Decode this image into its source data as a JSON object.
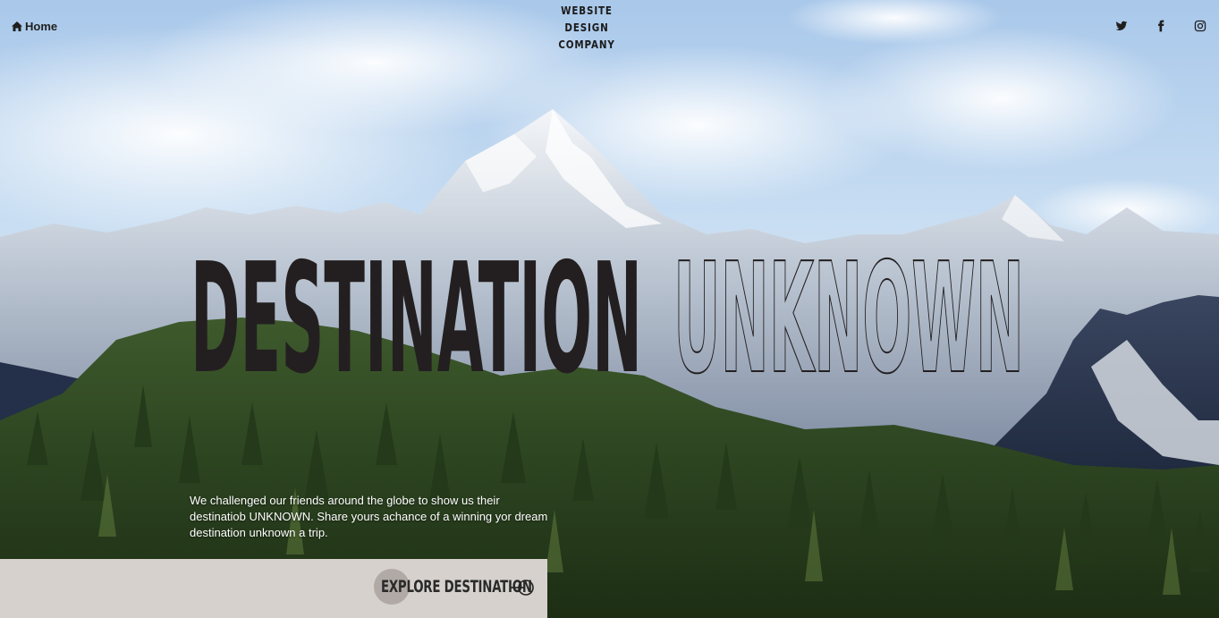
{
  "nav": {
    "home_label": "Home",
    "home_icon": "home-icon"
  },
  "brand": {
    "lines": [
      "WEBSITE",
      "DESIGN",
      "COMPANY"
    ]
  },
  "social": [
    {
      "name": "twitter-icon"
    },
    {
      "name": "facebook-icon"
    },
    {
      "name": "instagram-icon"
    }
  ],
  "hero": {
    "headline_solid": "DESTINATION",
    "headline_outline": "UNKNOWN",
    "tagline": "We challenged our friends around the globe to show us their destinatiob UNKNOWN. Share yours achance of a winning yor dream destination unknown a trip.",
    "background": "mountain-landscape"
  },
  "cta": {
    "label": "EXPLORE DESTINATION",
    "arrow_icon": "arrow-circle-icon"
  },
  "colors": {
    "headline": "#231f20",
    "cta_bar": "#d6d1cd",
    "cta_dot": "#a9a29e",
    "tagline": "#ffffff"
  }
}
